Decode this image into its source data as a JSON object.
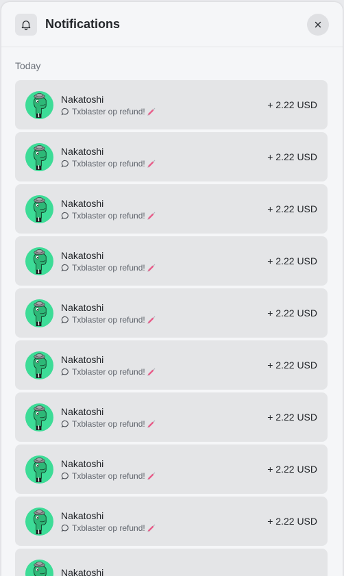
{
  "header": {
    "title": "Notifications"
  },
  "section": {
    "label": "Today"
  },
  "items": [
    {
      "name": "Nakatoshi",
      "message": "Txblaster op refund!",
      "amount": "+ 2.22 USD"
    },
    {
      "name": "Nakatoshi",
      "message": "Txblaster op refund!",
      "amount": "+ 2.22 USD"
    },
    {
      "name": "Nakatoshi",
      "message": "Txblaster op refund!",
      "amount": "+ 2.22 USD"
    },
    {
      "name": "Nakatoshi",
      "message": "Txblaster op refund!",
      "amount": "+ 2.22 USD"
    },
    {
      "name": "Nakatoshi",
      "message": "Txblaster op refund!",
      "amount": "+ 2.22 USD"
    },
    {
      "name": "Nakatoshi",
      "message": "Txblaster op refund!",
      "amount": "+ 2.22 USD"
    },
    {
      "name": "Nakatoshi",
      "message": "Txblaster op refund!",
      "amount": "+ 2.22 USD"
    },
    {
      "name": "Nakatoshi",
      "message": "Txblaster op refund!",
      "amount": "+ 2.22 USD"
    },
    {
      "name": "Nakatoshi",
      "message": "Txblaster op refund!",
      "amount": "+ 2.22 USD"
    },
    {
      "name": "Nakatoshi",
      "message": "",
      "amount": ""
    }
  ],
  "icons": {
    "header": "bell-icon",
    "close": "close-icon",
    "avatar": "dinosaur-avatar",
    "message": "chat-bubble-icon",
    "emoji": "syringe-emoji"
  },
  "colors": {
    "avatar_bg": "#3ddc97",
    "row_bg": "#e4e5e7",
    "panel_bg": "#f5f6f8"
  }
}
